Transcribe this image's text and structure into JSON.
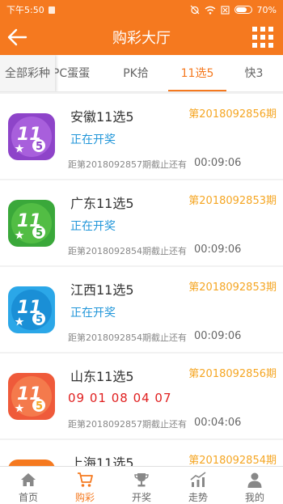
{
  "status_bar": {
    "time": "下午5:50",
    "battery": "70%"
  },
  "header": {
    "title": "购彩大厅"
  },
  "tabs": [
    {
      "label": "全部彩种"
    },
    {
      "label": "PC蛋蛋"
    },
    {
      "label": "PK拾"
    },
    {
      "label": "11选5",
      "active": true
    },
    {
      "label": "快3"
    }
  ],
  "lotteries": [
    {
      "name": "安徽11选5",
      "period": "第2018092856期",
      "status": "正在开奖",
      "deadline": "距第2018092857期截止还有",
      "countdown": "00:09:06",
      "color": "#8e44c9"
    },
    {
      "name": "广东11选5",
      "period": "第2018092853期",
      "status": "正在开奖",
      "deadline": "距第2018092854期截止还有",
      "countdown": "00:09:06",
      "color": "#3aa83a"
    },
    {
      "name": "江西11选5",
      "period": "第2018092853期",
      "status": "正在开奖",
      "deadline": "距第2018092854期截止还有",
      "countdown": "00:09:06",
      "color": "#2ba7e8"
    },
    {
      "name": "山东11选5",
      "period": "第2018092856期",
      "numbers": "09 01 08 04 07",
      "deadline": "距第2018092857期截止还有",
      "countdown": "00:04:06",
      "color": "#ef5a3a"
    },
    {
      "name": "上海11选5",
      "period": "第2018092854期",
      "color": "#f5791f"
    }
  ],
  "tabbar": [
    {
      "label": "首页",
      "icon": "home-icon"
    },
    {
      "label": "购彩",
      "icon": "cart-icon",
      "active": true
    },
    {
      "label": "开奖",
      "icon": "trophy-icon"
    },
    {
      "label": "走势",
      "icon": "trend-icon"
    },
    {
      "label": "我的",
      "icon": "user-icon"
    }
  ],
  "colors": {
    "brand": "#f5791f",
    "period": "#f5a623",
    "status": "#2196d9",
    "numbers": "#e02020"
  }
}
